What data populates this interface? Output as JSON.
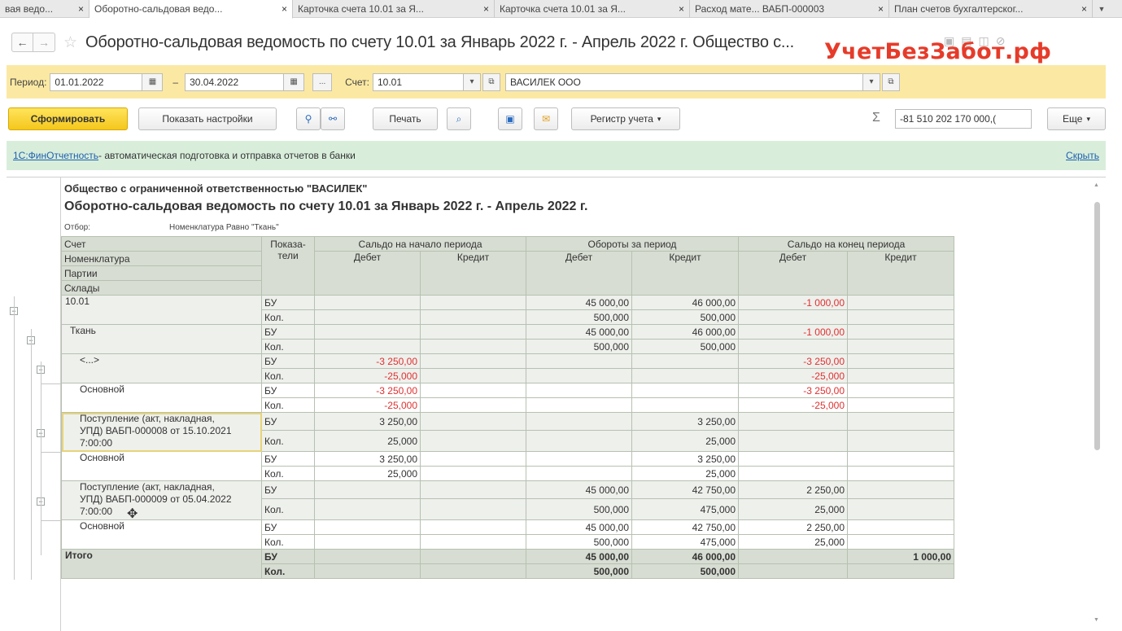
{
  "tabs": [
    {
      "label": "вая ведо...",
      "width": 110,
      "active": false
    },
    {
      "label": "Оборотно-сальдовая ведо...",
      "width": 250,
      "active": true
    },
    {
      "label": "Карточка счета 10.01 за Я...",
      "width": 248,
      "active": false
    },
    {
      "label": "Карточка счета 10.01 за Я...",
      "width": 240,
      "active": false
    },
    {
      "label": "Расход мате... ВАБП-000003",
      "width": 245,
      "active": false
    },
    {
      "label": "План счетов бухгалтерског...",
      "width": 250,
      "active": false
    }
  ],
  "tab_close": "×",
  "tab_menu": "▼",
  "window": {
    "back": "←",
    "forward": "→",
    "star": "☆",
    "title": "Оборотно-сальдовая ведомость по счету 10.01 за Январь 2022 г. - Апрель 2022 г. Общество с...",
    "watermark": "УчетБезЗабот.рф"
  },
  "period": {
    "label": "Период:",
    "from": "01.01.2022",
    "dash": "–",
    "to": "30.04.2022",
    "more": "...",
    "account_label": "Счет:",
    "account": "10.01",
    "org": "ВАСИЛЕК ООО"
  },
  "toolbar": {
    "generate": "Сформировать",
    "settings": "Показать настройки",
    "print": "Печать",
    "register": "Регистр учета",
    "sum_symbol": "Σ",
    "sum_value": "-81 510 202 170 000,(",
    "more": "Еще"
  },
  "info": {
    "link": "1С:ФинОтчетность",
    "text": " - автоматическая подготовка и отправка отчетов в банки",
    "hide": "Скрыть"
  },
  "report": {
    "org": "Общество с ограниченной ответственностью \"ВАСИЛЕК\"",
    "title": "Оборотно-сальдовая ведомость по счету 10.01 за Январь 2022 г. - Апрель 2022 г.",
    "filter_label": "Отбор:",
    "filter_value": "Номенклатура Равно \"Ткань\"",
    "header": {
      "account": "Счет",
      "nomenclature": "Номенклатура",
      "batches": "Партии",
      "warehouses": "Склады",
      "indicators": "Показа-\nтели",
      "opening": "Сальдо на начало периода",
      "turnover": "Обороты за период",
      "closing": "Сальдо на конец периода",
      "debit": "Дебет",
      "credit": "Кредит"
    },
    "rows": [
      {
        "name": "10.01",
        "indent": 0,
        "shade": "g",
        "lines": [
          {
            "ind": "БУ",
            "v": [
              "",
              "",
              "45 000,00",
              "46 000,00",
              "-1 000,00",
              ""
            ]
          },
          {
            "ind": "Кол.",
            "v": [
              "",
              "",
              "500,000",
              "500,000",
              "",
              ""
            ]
          }
        ]
      },
      {
        "name": "Ткань",
        "indent": 1,
        "shade": "g",
        "lines": [
          {
            "ind": "БУ",
            "v": [
              "",
              "",
              "45 000,00",
              "46 000,00",
              "-1 000,00",
              ""
            ]
          },
          {
            "ind": "Кол.",
            "v": [
              "",
              "",
              "500,000",
              "500,000",
              "",
              ""
            ]
          }
        ]
      },
      {
        "name": "<...>",
        "indent": 2,
        "shade": "g",
        "lines": [
          {
            "ind": "БУ",
            "v": [
              "-3 250,00",
              "",
              "",
              "",
              "-3 250,00",
              ""
            ]
          },
          {
            "ind": "Кол.",
            "v": [
              "-25,000",
              "",
              "",
              "",
              "-25,000",
              ""
            ]
          }
        ]
      },
      {
        "name": "Основной",
        "indent": 3,
        "shade": "w",
        "lines": [
          {
            "ind": "БУ",
            "v": [
              "-3 250,00",
              "",
              "",
              "",
              "-3 250,00",
              ""
            ]
          },
          {
            "ind": "Кол.",
            "v": [
              "-25,000",
              "",
              "",
              "",
              "-25,000",
              ""
            ]
          }
        ]
      },
      {
        "name": "Поступление (акт, накладная,\nУПД) ВАБП-000008 от 15.10.2021\n7:00:00",
        "indent": 2,
        "shade": "g",
        "selected": true,
        "lines": [
          {
            "ind": "БУ",
            "v": [
              "3 250,00",
              "",
              "",
              "3 250,00",
              "",
              ""
            ]
          },
          {
            "ind": "Кол.",
            "v": [
              "25,000",
              "",
              "",
              "25,000",
              "",
              ""
            ]
          }
        ]
      },
      {
        "name": "Основной",
        "indent": 3,
        "shade": "w",
        "lines": [
          {
            "ind": "БУ",
            "v": [
              "3 250,00",
              "",
              "",
              "3 250,00",
              "",
              ""
            ]
          },
          {
            "ind": "Кол.",
            "v": [
              "25,000",
              "",
              "",
              "25,000",
              "",
              ""
            ]
          }
        ]
      },
      {
        "name": "Поступление (акт, накладная,\nУПД) ВАБП-000009 от 05.04.2022\n7:00:00",
        "indent": 2,
        "shade": "g",
        "lines": [
          {
            "ind": "БУ",
            "v": [
              "",
              "",
              "45 000,00",
              "42 750,00",
              "2 250,00",
              ""
            ]
          },
          {
            "ind": "Кол.",
            "v": [
              "",
              "",
              "500,000",
              "475,000",
              "25,000",
              ""
            ]
          }
        ]
      },
      {
        "name": "Основной",
        "indent": 3,
        "shade": "w",
        "lines": [
          {
            "ind": "БУ",
            "v": [
              "",
              "",
              "45 000,00",
              "42 750,00",
              "2 250,00",
              ""
            ]
          },
          {
            "ind": "Кол.",
            "v": [
              "",
              "",
              "500,000",
              "475,000",
              "25,000",
              ""
            ]
          }
        ]
      }
    ],
    "total": {
      "name": "Итого",
      "lines": [
        {
          "ind": "БУ",
          "v": [
            "",
            "",
            "45 000,00",
            "46 000,00",
            "",
            "1 000,00"
          ]
        },
        {
          "ind": "Кол.",
          "v": [
            "",
            "",
            "500,000",
            "500,000",
            "",
            ""
          ]
        }
      ]
    }
  }
}
